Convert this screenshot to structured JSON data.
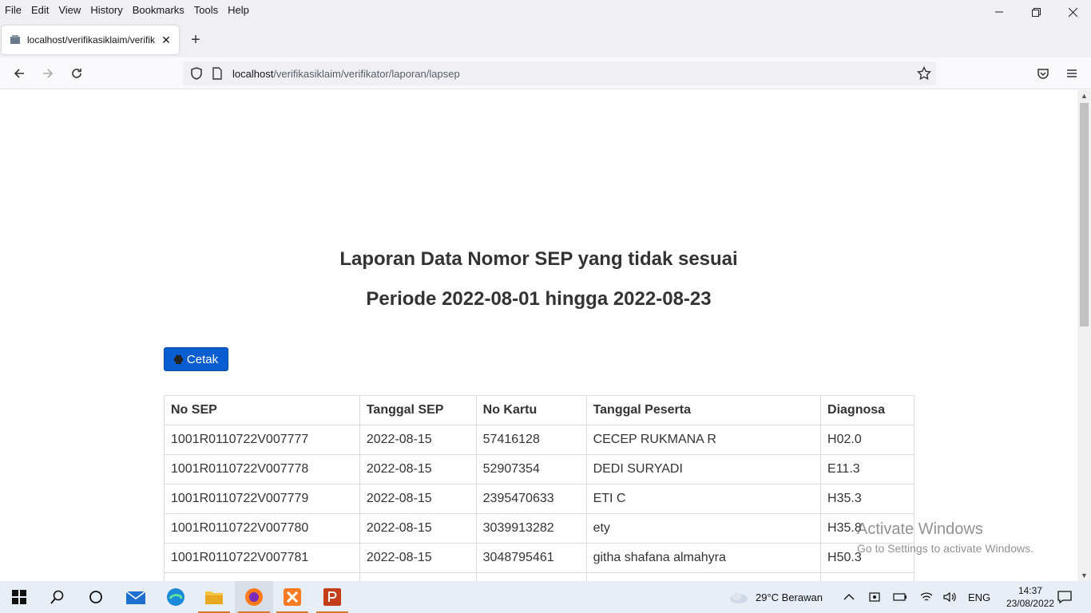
{
  "menu": [
    "File",
    "Edit",
    "View",
    "History",
    "Bookmarks",
    "Tools",
    "Help"
  ],
  "tab": {
    "title": "localhost/verifikasiklaim/verifik",
    "close": "✕"
  },
  "newtab": "+",
  "url": {
    "host": "localhost",
    "path": "/verifikasiklaim/verifikator/laporan/lapsep"
  },
  "page": {
    "title": "Laporan Data Nomor SEP yang tidak sesuai",
    "period": "Periode 2022-08-01 hingga 2022-08-23",
    "print_label": "Cetak"
  },
  "table": {
    "headers": [
      "No SEP",
      "Tanggal SEP",
      "No Kartu",
      "Tanggal Peserta",
      "Diagnosa"
    ],
    "rows": [
      [
        "1001R0110722V007777",
        "2022-08-15",
        "57416128",
        "CECEP RUKMANA R",
        "H02.0"
      ],
      [
        "1001R0110722V007778",
        "2022-08-15",
        "52907354",
        "DEDI SURYADI",
        "E11.3"
      ],
      [
        "1001R0110722V007779",
        "2022-08-15",
        "2395470633",
        "ETI C",
        "H35.3"
      ],
      [
        "1001R0110722V007780",
        "2022-08-15",
        "3039913282",
        "ety",
        "H35.8"
      ],
      [
        "1001R0110722V007781",
        "2022-08-15",
        "3048795461",
        "githa shafana almahyra",
        "H50.3"
      ]
    ]
  },
  "watermark": {
    "line1": "Activate Windows",
    "line2": "Go to Settings to activate Windows."
  },
  "taskbar": {
    "weather": "29°C  Berawan",
    "lang": "ENG",
    "time": "14:37",
    "date": "23/08/2022"
  }
}
